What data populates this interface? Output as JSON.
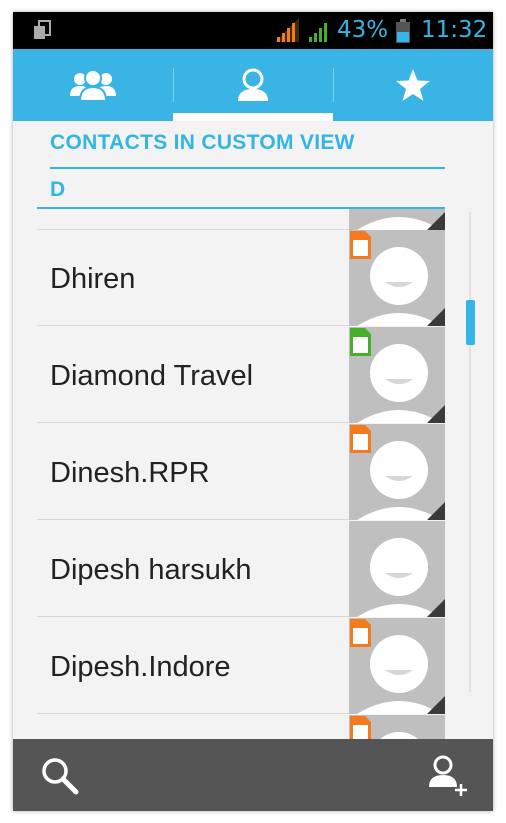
{
  "status_bar": {
    "battery_percent": "43%",
    "time": "11:32",
    "icons": [
      "sim-card-icon",
      "signal-orange-icon",
      "signal-green-icon",
      "battery-icon"
    ],
    "accent_color": "#33b5e5"
  },
  "tabs": [
    {
      "icon": "groups-icon"
    },
    {
      "icon": "person-icon",
      "selected": true
    },
    {
      "icon": "star-icon"
    }
  ],
  "section_title": "CONTACTS IN CUSTOM VIEW",
  "letter_header": "D",
  "contacts": [
    {
      "name": "",
      "sim": "none"
    },
    {
      "name": "Dhiren",
      "sim": "orange"
    },
    {
      "name": "Diamond Travel",
      "sim": "green"
    },
    {
      "name": "Dinesh.RPR",
      "sim": "orange"
    },
    {
      "name": "Dipesh harsukh",
      "sim": "none"
    },
    {
      "name": "Dipesh.Indore",
      "sim": "orange"
    },
    {
      "name": "",
      "sim": "orange"
    }
  ],
  "bottom_bar": {
    "search_icon": "search-icon",
    "add_contact_icon": "add-contact-icon"
  },
  "colors": {
    "tab_bar": "#39b4e4",
    "sim_orange": "#f47a20",
    "sim_green": "#45b029",
    "bottom_bar": "#555555"
  }
}
